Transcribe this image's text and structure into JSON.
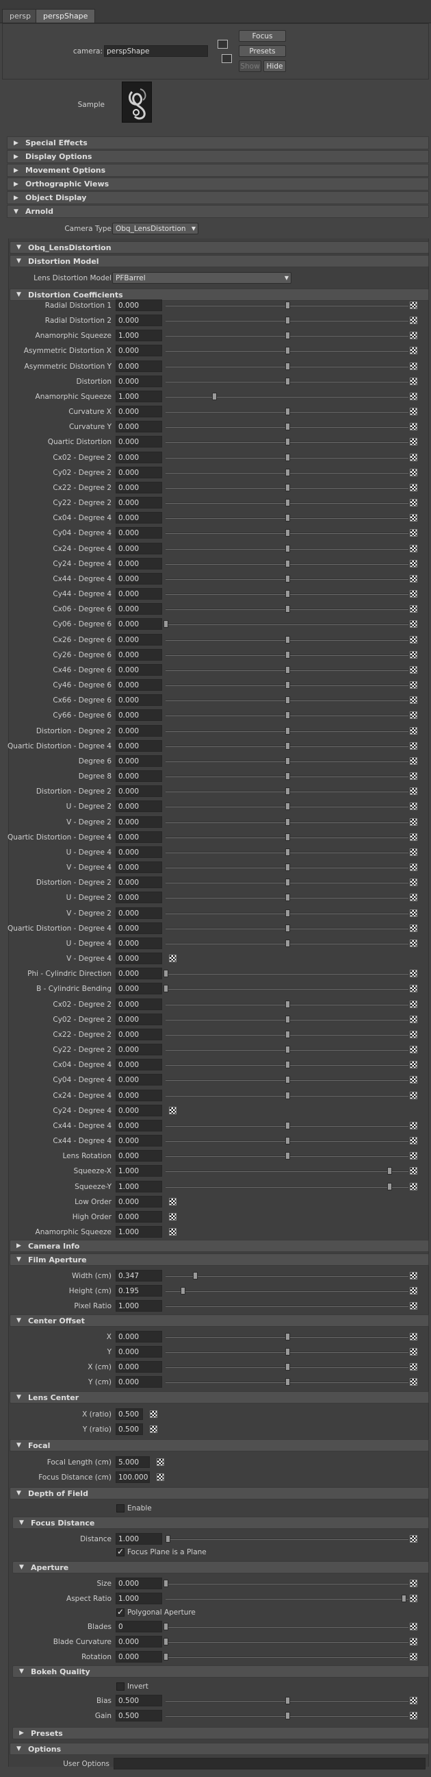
{
  "tabs": [
    "persp",
    "perspShape"
  ],
  "header": {
    "camera_label": "camera:",
    "camera_value": "perspShape",
    "focus_btn": "Focus",
    "presets_btn": "Presets",
    "show_btn": "Show",
    "hide_btn": "Hide"
  },
  "sample_label": "Sample",
  "sections": [
    "Special Effects",
    "Display Options",
    "Movement Options",
    "Orthographic Views",
    "Object Display",
    "Arnold"
  ],
  "arnold": {
    "camera_type_label": "Camera Type",
    "camera_type_value": "Obq_LensDistortion",
    "obq_title": "Obq_LensDistortion",
    "distortion_model_title": "Distortion Model",
    "lens_model_label": "Lens Distortion Model",
    "lens_model_value": "PFBarrel",
    "coefficients_title": "Distortion Coefficients"
  },
  "coefficients": [
    {
      "label": "Radial Distortion 1",
      "value": "0.000",
      "slider": 0.5
    },
    {
      "label": "Radial Distortion 2",
      "value": "0.000",
      "slider": 0.5
    },
    {
      "label": "Anamorphic Squeeze",
      "value": "1.000",
      "slider": 0.5
    },
    {
      "label": "Asymmetric Distortion X",
      "value": "0.000",
      "slider": 0.5
    },
    {
      "label": "Asymmetric Distortion Y",
      "value": "0.000",
      "slider": 0.5
    },
    {
      "label": "Distortion",
      "value": "0.000",
      "slider": 0.5
    },
    {
      "label": "Anamorphic Squeeze",
      "value": "1.000",
      "slider": 0.2
    },
    {
      "label": "Curvature X",
      "value": "0.000",
      "slider": 0.5
    },
    {
      "label": "Curvature Y",
      "value": "0.000",
      "slider": 0.5
    },
    {
      "label": "Quartic Distortion",
      "value": "0.000",
      "slider": 0.5
    },
    {
      "label": "Cx02 - Degree 2",
      "value": "0.000",
      "slider": 0.5
    },
    {
      "label": "Cy02 - Degree 2",
      "value": "0.000",
      "slider": 0.5
    },
    {
      "label": "Cx22 - Degree 2",
      "value": "0.000",
      "slider": 0.5
    },
    {
      "label": "Cy22 - Degree 2",
      "value": "0.000",
      "slider": 0.5
    },
    {
      "label": "Cx04 - Degree 4",
      "value": "0.000",
      "slider": 0.5
    },
    {
      "label": "Cy04 - Degree 4",
      "value": "0.000",
      "slider": 0.5
    },
    {
      "label": "Cx24 - Degree 4",
      "value": "0.000",
      "slider": 0.5
    },
    {
      "label": "Cy24 - Degree 4",
      "value": "0.000",
      "slider": 0.5
    },
    {
      "label": "Cx44 - Degree 4",
      "value": "0.000",
      "slider": 0.5
    },
    {
      "label": "Cy44 - Degree 4",
      "value": "0.000",
      "slider": 0.5
    },
    {
      "label": "Cx06 - Degree 6",
      "value": "0.000",
      "slider": 0.5
    },
    {
      "label": "Cy06 - Degree 6",
      "value": "0.000",
      "slider": 0.0
    },
    {
      "label": "Cx26 - Degree 6",
      "value": "0.000",
      "slider": 0.5
    },
    {
      "label": "Cy26 - Degree 6",
      "value": "0.000",
      "slider": 0.5
    },
    {
      "label": "Cx46 - Degree 6",
      "value": "0.000",
      "slider": 0.5
    },
    {
      "label": "Cy46 - Degree 6",
      "value": "0.000",
      "slider": 0.5
    },
    {
      "label": "Cx66 - Degree 6",
      "value": "0.000",
      "slider": 0.5
    },
    {
      "label": "Cy66 - Degree 6",
      "value": "0.000",
      "slider": 0.5
    },
    {
      "label": "Distortion - Degree 2",
      "value": "0.000",
      "slider": 0.5
    },
    {
      "label": "Quartic Distortion - Degree 4",
      "value": "0.000",
      "slider": 0.5
    },
    {
      "label": "Degree 6",
      "value": "0.000",
      "slider": 0.5
    },
    {
      "label": "Degree 8",
      "value": "0.000",
      "slider": 0.5
    },
    {
      "label": "Distortion - Degree 2",
      "value": "0.000",
      "slider": 0.5
    },
    {
      "label": "U - Degree 2",
      "value": "0.000",
      "slider": 0.5
    },
    {
      "label": "V - Degree 2",
      "value": "0.000",
      "slider": 0.5
    },
    {
      "label": "Quartic Distortion - Degree 4",
      "value": "0.000",
      "slider": 0.5
    },
    {
      "label": "U - Degree 4",
      "value": "0.000",
      "slider": 0.5
    },
    {
      "label": "V - Degree 4",
      "value": "0.000",
      "slider": 0.5
    },
    {
      "label": "Distortion - Degree 2",
      "value": "0.000",
      "slider": 0.5
    },
    {
      "label": "U - Degree 2",
      "value": "0.000",
      "slider": 0.5
    },
    {
      "label": "V - Degree 2",
      "value": "0.000",
      "slider": 0.5
    },
    {
      "label": "Quartic Distortion - Degree 4",
      "value": "0.000",
      "slider": 0.5
    },
    {
      "label": "U - Degree 4",
      "value": "0.000",
      "slider": 0.5
    },
    {
      "label": "V - Degree 4",
      "value": "0.000",
      "slider": null
    },
    {
      "label": "Phi - Cylindric Direction",
      "value": "0.000",
      "slider": 0.0
    },
    {
      "label": "B - Cylindric Bending",
      "value": "0.000",
      "slider": 0.0
    },
    {
      "label": "Cx02 - Degree 2",
      "value": "0.000",
      "slider": 0.5
    },
    {
      "label": "Cy02 - Degree 2",
      "value": "0.000",
      "slider": 0.5
    },
    {
      "label": "Cx22 - Degree 2",
      "value": "0.000",
      "slider": 0.5
    },
    {
      "label": "Cy22 - Degree 2",
      "value": "0.000",
      "slider": 0.5
    },
    {
      "label": "Cx04 - Degree 4",
      "value": "0.000",
      "slider": 0.5
    },
    {
      "label": "Cy04 - Degree 4",
      "value": "0.000",
      "slider": 0.5
    },
    {
      "label": "Cx24 - Degree 4",
      "value": "0.000",
      "slider": 0.5
    },
    {
      "label": "Cy24 - Degree 4",
      "value": "0.000",
      "slider": null
    },
    {
      "label": "Cx44 - Degree 4",
      "value": "0.000",
      "slider": 0.5
    },
    {
      "label": "Cx44 - Degree 4",
      "value": "0.000",
      "slider": 0.5
    },
    {
      "label": "Lens Rotation",
      "value": "0.000",
      "slider": 0.5
    },
    {
      "label": "Squeeze-X",
      "value": "1.000",
      "slider": 0.92
    },
    {
      "label": "Squeeze-Y",
      "value": "1.000",
      "slider": 0.92
    },
    {
      "label": "Low Order",
      "value": "0.000",
      "slider": null
    },
    {
      "label": "High Order",
      "value": "0.000",
      "slider": null
    },
    {
      "label": "Anamorphic Squeeze",
      "value": "1.000",
      "slider": null
    }
  ],
  "camera_info_title": "Camera Info",
  "film_aperture": {
    "title": "Film Aperture",
    "rows": [
      {
        "label": "Width (cm)",
        "value": "0.347",
        "slider": 0.12
      },
      {
        "label": "Height (cm)",
        "value": "0.195",
        "slider": 0.07
      },
      {
        "label": "Pixel Ratio",
        "value": "1.000",
        "slider": null,
        "bar": true
      }
    ]
  },
  "center_offset": {
    "title": "Center Offset",
    "rows": [
      {
        "label": "X",
        "value": "0.000",
        "slider": 0.5
      },
      {
        "label": "Y",
        "value": "0.000",
        "slider": 0.5
      },
      {
        "label": "X (cm)",
        "value": "0.000",
        "slider": 0.5
      },
      {
        "label": "Y (cm)",
        "value": "0.000",
        "slider": 0.5
      }
    ]
  },
  "lens_center": {
    "title": "Lens Center",
    "rows": [
      {
        "label": "X (ratio)",
        "value": "0.500",
        "slider": null
      },
      {
        "label": "Y (ratio)",
        "value": "0.500",
        "slider": null
      }
    ]
  },
  "focal": {
    "title": "Focal",
    "rows": [
      {
        "label": "Focal Length (cm)",
        "value": "5.000",
        "slider": null
      },
      {
        "label": "Focus Distance (cm)",
        "value": "100.000",
        "slider": null
      }
    ]
  },
  "depth_of_field": {
    "title": "Depth of Field",
    "enable_label": "Enable"
  },
  "focus_distance": {
    "title": "Focus Distance",
    "distance_label": "Distance",
    "distance_value": "1.000",
    "plane_label": "Focus Plane is a Plane"
  },
  "aperture": {
    "title": "Aperture",
    "rows": [
      {
        "label": "Size",
        "value": "0.000",
        "slider": 0.0
      },
      {
        "label": "Aspect Ratio",
        "value": "1.000",
        "slider": 0.98
      }
    ],
    "polygonal_label": "Polygonal Aperture",
    "rows2": [
      {
        "label": "Blades",
        "value": "0",
        "slider": 0.0
      },
      {
        "label": "Blade Curvature",
        "value": "0.000",
        "slider": 0.0
      },
      {
        "label": "Rotation",
        "value": "0.000",
        "slider": 0.0
      }
    ]
  },
  "bokeh": {
    "title": "Bokeh Quality",
    "invert_label": "Invert",
    "rows": [
      {
        "label": "Bias",
        "value": "0.500",
        "slider": 0.5
      },
      {
        "label": "Gain",
        "value": "0.500",
        "slider": 0.5
      }
    ]
  },
  "presets_title": "Presets",
  "options_title": "Options",
  "user_options_label": "User Options",
  "user_options_value": ""
}
